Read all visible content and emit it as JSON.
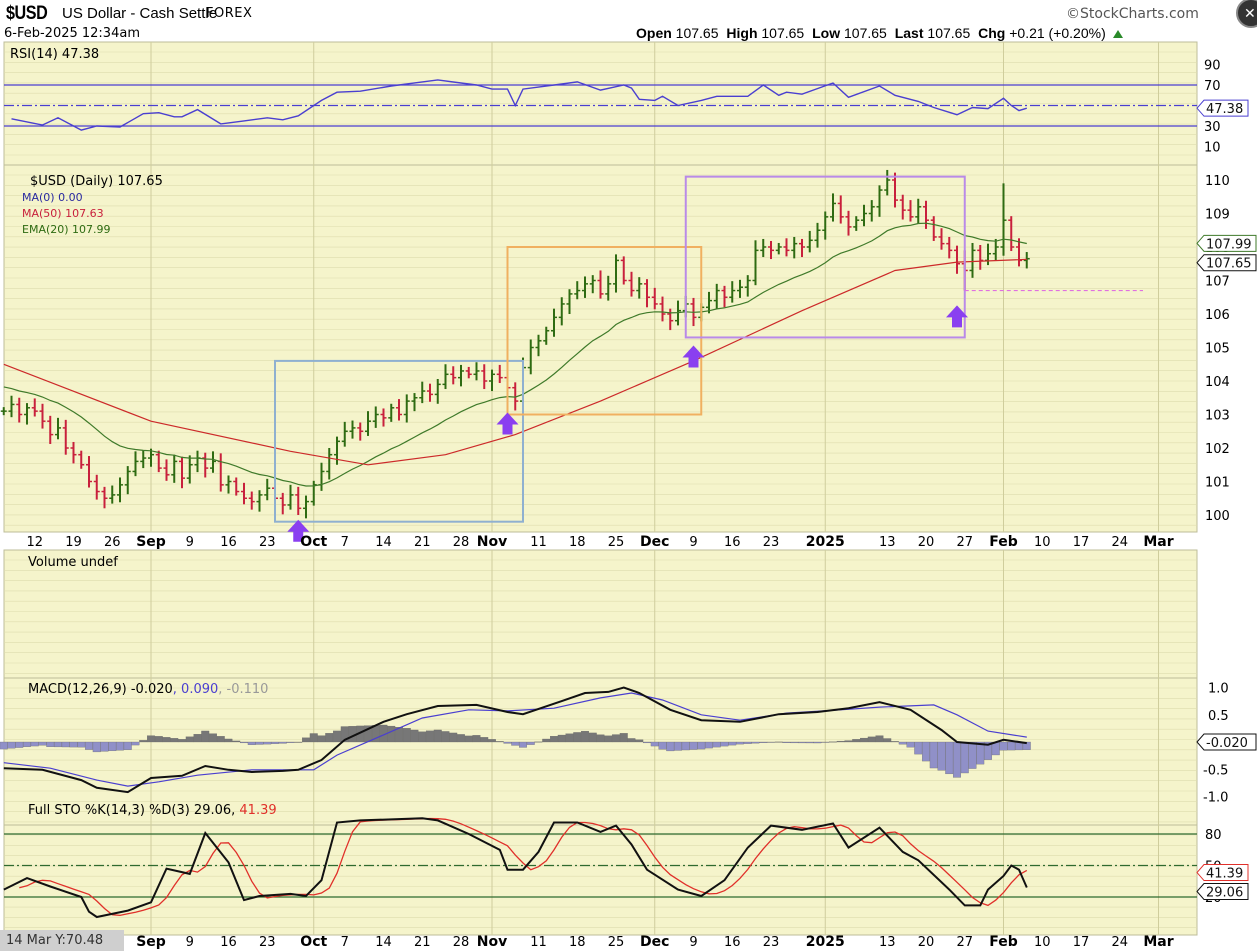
{
  "header": {
    "symbol": "$USD",
    "name": "US Dollar - Cash Settle",
    "exchange": "FOREX",
    "datetime": "6-Feb-2025 12:34am",
    "brand": "©StockCharts.com",
    "open_label": "Open",
    "open": "107.65",
    "high_label": "High",
    "high": "107.65",
    "low_label": "Low",
    "low": "107.65",
    "last_label": "Last",
    "last": "107.65",
    "chg_label": "Chg",
    "chg": "+0.21 (+0.20%)"
  },
  "colors": {
    "panel_bg": "#f5f4cb",
    "grid": "#dedcae",
    "up": "#2e6b12",
    "down": "#c8203c",
    "ma50": "#cc2a2a",
    "ema20": "#3f7a2a",
    "rsi": "#4a3fd0",
    "macd": "#111111",
    "signal": "#4a3fd0",
    "hist_pos": "#777777",
    "hist_neg": "#9090c8",
    "sto_k": "#111111",
    "sto_d": "#e0302a",
    "sto_lines": "#2f6a2f",
    "box_blue": "#8fb0d0",
    "box_orange": "#f0b060",
    "box_purple": "#b98ae8",
    "arrow": "#8a3ff0",
    "support": "#e070e0"
  },
  "legends": {
    "rsi": "RSI(14) 47.38",
    "price": "$USD (Daily) 107.65",
    "ma0": "MA(0) 0.00",
    "ma50": "MA(50) 107.63",
    "ema20": "EMA(20) 107.99",
    "volume": "Volume undef",
    "macd_a": "MACD(12,26,9) -0.020",
    "macd_b": ", 0.090",
    "macd_c": ", -0.110",
    "sto_a": "Full STO %K(14,3) %D(3) 29.06,",
    "sto_b": " 41.39"
  },
  "cursor_readout": "14 Mar Y:70.48",
  "chart_data": {
    "type": "ohlc",
    "title": "$USD US Dollar - Cash Settle FOREX (Daily)",
    "time_unit": "trading days since 2024-09-02",
    "date_labels": [
      {
        "label": "12",
        "t": -15
      },
      {
        "label": "19",
        "t": -10
      },
      {
        "label": "26",
        "t": -5
      },
      {
        "label": "Sep",
        "t": 0,
        "bold": true
      },
      {
        "label": "9",
        "t": 5
      },
      {
        "label": "16",
        "t": 10
      },
      {
        "label": "23",
        "t": 15
      },
      {
        "label": "Oct",
        "t": 21,
        "bold": true
      },
      {
        "label": "7",
        "t": 25
      },
      {
        "label": "14",
        "t": 30
      },
      {
        "label": "21",
        "t": 35
      },
      {
        "label": "28",
        "t": 40
      },
      {
        "label": "Nov",
        "t": 44,
        "bold": true
      },
      {
        "label": "11",
        "t": 50
      },
      {
        "label": "18",
        "t": 55
      },
      {
        "label": "25",
        "t": 60
      },
      {
        "label": "Dec",
        "t": 65,
        "bold": true
      },
      {
        "label": "9",
        "t": 70
      },
      {
        "label": "16",
        "t": 75
      },
      {
        "label": "23",
        "t": 80
      },
      {
        "label": "2025",
        "t": 87,
        "bold": true
      },
      {
        "label": "13",
        "t": 95
      },
      {
        "label": "20",
        "t": 100
      },
      {
        "label": "27",
        "t": 105
      },
      {
        "label": "Feb",
        "t": 110,
        "bold": true
      },
      {
        "label": "10",
        "t": 115
      },
      {
        "label": "17",
        "t": 120
      },
      {
        "label": "24",
        "t": 125
      },
      {
        "label": "Mar",
        "t": 130,
        "bold": true
      }
    ],
    "month_gridlines_t": [
      0,
      21,
      44,
      65,
      87,
      110,
      130
    ],
    "price": {
      "ylim": [
        99.6,
        110.5
      ],
      "ticks": [
        "110",
        "109",
        "108",
        "107",
        "106",
        "105",
        "104",
        "103",
        "102",
        "101",
        "100"
      ],
      "start_t": -19,
      "closes": [
        103.1,
        103.3,
        103.0,
        103.2,
        103.1,
        102.8,
        102.4,
        102.6,
        102.0,
        101.8,
        101.5,
        101.0,
        100.7,
        100.5,
        100.6,
        100.9,
        101.3,
        101.6,
        101.7,
        101.8,
        101.4,
        101.2,
        101.6,
        101.1,
        101.5,
        101.7,
        101.4,
        101.6,
        100.9,
        101.0,
        100.7,
        100.5,
        100.4,
        100.6,
        100.8,
        100.5,
        100.3,
        100.6,
        100.2,
        100.4,
        100.9,
        101.3,
        101.8,
        102.2,
        102.5,
        102.6,
        102.5,
        102.8,
        103.0,
        102.9,
        103.2,
        103.0,
        103.4,
        103.5,
        103.7,
        103.6,
        103.9,
        104.2,
        104.1,
        104.3,
        104.2,
        104.3,
        104.0,
        104.2,
        104.1,
        103.8,
        103.4,
        104.4,
        105.0,
        105.2,
        105.5,
        105.9,
        106.3,
        106.6,
        106.7,
        106.9,
        107.0,
        106.6,
        106.9,
        107.6,
        107.0,
        106.7,
        106.9,
        106.5,
        106.3,
        106.0,
        105.8,
        106.1,
        106.3,
        105.9,
        106.2,
        106.4,
        106.7,
        106.5,
        106.7,
        106.8,
        107.0,
        107.9,
        108.0,
        107.9,
        108.0,
        107.9,
        108.1,
        108.0,
        108.2,
        108.5,
        108.9,
        109.3,
        108.9,
        108.6,
        108.8,
        109.0,
        109.2,
        109.7,
        110.0,
        109.4,
        109.1,
        108.9,
        109.2,
        108.8,
        108.3,
        108.1,
        107.9,
        107.5,
        107.3,
        107.9,
        107.6,
        107.8,
        108.0,
        108.8,
        108.0,
        107.6,
        107.65
      ],
      "high_overrides": [
        [
          110,
          109.9
        ],
        [
          95,
          110.3
        ],
        [
          105,
          107.9
        ]
      ],
      "low_overrides": [
        [
          105,
          106.7
        ],
        [
          20,
          99.9
        ]
      ],
      "ma50": [
        [
          -19,
          104.5
        ],
        [
          0,
          102.8
        ],
        [
          18,
          101.9
        ],
        [
          28,
          101.5
        ],
        [
          38,
          101.8
        ],
        [
          47,
          102.4
        ],
        [
          58,
          103.4
        ],
        [
          70,
          104.6
        ],
        [
          84,
          106.1
        ],
        [
          96,
          107.3
        ],
        [
          104,
          107.55
        ],
        [
          113,
          107.63
        ]
      ],
      "ema20_seed": 103.9,
      "last_labels": [
        {
          "value": "107.99",
          "price": 107.99,
          "color": "#3f7a2a"
        },
        {
          "value": "107.65",
          "price": 107.65,
          "color": "#111111"
        }
      ],
      "boxes": [
        {
          "name": "blue-consolidation-box",
          "t0": 16,
          "t1": 48,
          "p0": 99.8,
          "p1": 104.6,
          "color": "box_blue"
        },
        {
          "name": "orange-consolidation-box",
          "t0": 46,
          "t1": 71,
          "p0": 103.0,
          "p1": 108.0,
          "color": "box_orange"
        },
        {
          "name": "purple-consolidation-box",
          "t0": 69,
          "t1": 105,
          "p0": 105.3,
          "p1": 110.1,
          "color": "box_purple"
        }
      ],
      "arrows": [
        {
          "t": 19,
          "p": 99.5
        },
        {
          "t": 46,
          "p": 102.7
        },
        {
          "t": 70,
          "p": 104.7
        },
        {
          "t": 104,
          "p": 105.9
        }
      ],
      "support_line": {
        "t0": 105,
        "t1": 128,
        "p": 106.7
      }
    },
    "rsi": {
      "ylim": [
        0,
        100
      ],
      "ticks": [
        "90",
        "70",
        "30",
        "10"
      ],
      "last": "47.38",
      "points": [
        [
          -18,
          37
        ],
        [
          -14,
          31
        ],
        [
          -12,
          38
        ],
        [
          -9,
          26
        ],
        [
          -7,
          30
        ],
        [
          -4,
          29
        ],
        [
          -1,
          42
        ],
        [
          1,
          43
        ],
        [
          3,
          39
        ],
        [
          4,
          39
        ],
        [
          6,
          46
        ],
        [
          9,
          32
        ],
        [
          12,
          35
        ],
        [
          15,
          38
        ],
        [
          17,
          36
        ],
        [
          19,
          40
        ],
        [
          22,
          55
        ],
        [
          24,
          63
        ],
        [
          27,
          64
        ],
        [
          31,
          69
        ],
        [
          35,
          73
        ],
        [
          37,
          75
        ],
        [
          40,
          72
        ],
        [
          42,
          70
        ],
        [
          44,
          66
        ],
        [
          46,
          66
        ],
        [
          47,
          50
        ],
        [
          48,
          66
        ],
        [
          53,
          71
        ],
        [
          55,
          73
        ],
        [
          58,
          65
        ],
        [
          61,
          70
        ],
        [
          62,
          67
        ],
        [
          63,
          56
        ],
        [
          65,
          55
        ],
        [
          66,
          59
        ],
        [
          68,
          50
        ],
        [
          71,
          55
        ],
        [
          73,
          59
        ],
        [
          77,
          59
        ],
        [
          79,
          70
        ],
        [
          81,
          60
        ],
        [
          82,
          63
        ],
        [
          84,
          61
        ],
        [
          88,
          72
        ],
        [
          90,
          58
        ],
        [
          94,
          69
        ],
        [
          96,
          60
        ],
        [
          99,
          54
        ],
        [
          101,
          48
        ],
        [
          104,
          41
        ],
        [
          106,
          48
        ],
        [
          108,
          47
        ],
        [
          110,
          57
        ],
        [
          111,
          50
        ],
        [
          112,
          45
        ],
        [
          113,
          47.38
        ]
      ]
    },
    "macd": {
      "ylim": [
        -1.2,
        1.2
      ],
      "ticks": [
        "1.0",
        "0.5",
        "-0.5",
        "-1.0"
      ],
      "last": "-0.020",
      "macd": [
        [
          -19,
          -0.48
        ],
        [
          -14,
          -0.51
        ],
        [
          -9,
          -0.7
        ],
        [
          -7,
          -0.84
        ],
        [
          -3,
          -0.92
        ],
        [
          0,
          -0.66
        ],
        [
          4,
          -0.62
        ],
        [
          7,
          -0.44
        ],
        [
          10,
          -0.51
        ],
        [
          13,
          -0.55
        ],
        [
          17,
          -0.53
        ],
        [
          19,
          -0.51
        ],
        [
          22,
          -0.33
        ],
        [
          25,
          0.04
        ],
        [
          30,
          0.37
        ],
        [
          33,
          0.51
        ],
        [
          37,
          0.66
        ],
        [
          42,
          0.68
        ],
        [
          46,
          0.55
        ],
        [
          48,
          0.51
        ],
        [
          53,
          0.75
        ],
        [
          56,
          0.9
        ],
        [
          59,
          0.92
        ],
        [
          61,
          1.0
        ],
        [
          63,
          0.9
        ],
        [
          67,
          0.59
        ],
        [
          71,
          0.4
        ],
        [
          76,
          0.37
        ],
        [
          81,
          0.51
        ],
        [
          86,
          0.55
        ],
        [
          90,
          0.62
        ],
        [
          94,
          0.73
        ],
        [
          98,
          0.59
        ],
        [
          102,
          0.22
        ],
        [
          104,
          0.0
        ],
        [
          108,
          -0.05
        ],
        [
          110,
          0.04
        ],
        [
          113,
          -0.02
        ]
      ],
      "signal": [
        [
          -19,
          -0.38
        ],
        [
          -13,
          -0.48
        ],
        [
          -7,
          -0.7
        ],
        [
          -3,
          -0.81
        ],
        [
          1,
          -0.73
        ],
        [
          6,
          -0.61
        ],
        [
          13,
          -0.51
        ],
        [
          21,
          -0.51
        ],
        [
          24,
          -0.24
        ],
        [
          30,
          0.13
        ],
        [
          35,
          0.44
        ],
        [
          41,
          0.59
        ],
        [
          46,
          0.57
        ],
        [
          52,
          0.62
        ],
        [
          58,
          0.81
        ],
        [
          62,
          0.9
        ],
        [
          66,
          0.77
        ],
        [
          71,
          0.5
        ],
        [
          76,
          0.4
        ],
        [
          82,
          0.53
        ],
        [
          89,
          0.59
        ],
        [
          94,
          0.64
        ],
        [
          101,
          0.68
        ],
        [
          104,
          0.5
        ],
        [
          108,
          0.2
        ],
        [
          113,
          0.09
        ]
      ]
    },
    "sto": {
      "ylim": [
        0,
        100
      ],
      "ticks": [
        "80",
        "50",
        "20"
      ],
      "k_last": "29.06",
      "d_last": "41.39",
      "k": [
        [
          -19,
          27
        ],
        [
          -16,
          38
        ],
        [
          -13,
          30
        ],
        [
          -9,
          20
        ],
        [
          -8,
          6
        ],
        [
          -7,
          1
        ],
        [
          -3,
          7
        ],
        [
          0,
          15
        ],
        [
          2,
          47
        ],
        [
          5,
          42
        ],
        [
          7,
          81
        ],
        [
          10,
          53
        ],
        [
          12,
          17
        ],
        [
          14,
          21
        ],
        [
          18,
          23
        ],
        [
          20,
          21
        ],
        [
          22,
          36
        ],
        [
          24,
          91
        ],
        [
          27,
          93
        ],
        [
          35,
          95
        ],
        [
          37,
          93
        ],
        [
          41,
          80
        ],
        [
          45,
          65
        ],
        [
          46,
          46
        ],
        [
          48,
          46
        ],
        [
          50,
          63
        ],
        [
          52,
          91
        ],
        [
          55,
          91
        ],
        [
          58,
          82
        ],
        [
          60,
          88
        ],
        [
          62,
          70
        ],
        [
          64,
          46
        ],
        [
          68,
          27
        ],
        [
          71,
          21
        ],
        [
          74,
          36
        ],
        [
          77,
          67
        ],
        [
          80,
          88
        ],
        [
          84,
          84
        ],
        [
          88,
          90
        ],
        [
          90,
          67
        ],
        [
          94,
          86
        ],
        [
          97,
          63
        ],
        [
          99,
          55
        ],
        [
          103,
          27
        ],
        [
          105,
          12
        ],
        [
          107,
          12
        ],
        [
          108,
          27
        ],
        [
          110,
          40
        ],
        [
          111,
          50
        ],
        [
          112,
          46
        ],
        [
          113,
          29.06
        ]
      ]
    }
  }
}
